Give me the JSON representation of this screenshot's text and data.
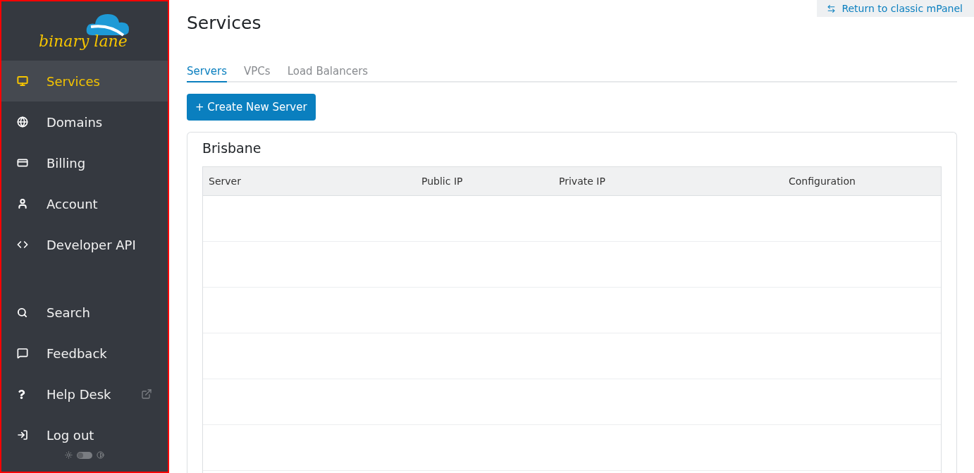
{
  "sidebar": {
    "logo": {
      "text": "binary lane"
    },
    "items": [
      {
        "kind": "monitor",
        "label": "Services",
        "selected": true,
        "external": false
      },
      {
        "kind": "globe",
        "label": "Domains",
        "selected": false,
        "external": false
      },
      {
        "kind": "card",
        "label": "Billing",
        "selected": false,
        "external": false
      },
      {
        "kind": "user",
        "label": "Account",
        "selected": false,
        "external": false
      },
      {
        "kind": "code",
        "label": "Developer API",
        "selected": false,
        "external": false
      }
    ],
    "bottom_items": [
      {
        "kind": "search",
        "label": "Search",
        "selected": false,
        "external": false
      },
      {
        "kind": "feedback",
        "label": "Feedback",
        "selected": false,
        "external": false
      },
      {
        "kind": "help",
        "label": "Help Desk",
        "selected": false,
        "external": true
      },
      {
        "kind": "logout",
        "label": "Log out",
        "selected": false,
        "external": false
      }
    ],
    "theme_toggle": {
      "on": false
    }
  },
  "classic_link": "Return to classic mPanel",
  "page_title": "Services",
  "tabs": [
    {
      "label": "Servers",
      "selected": true
    },
    {
      "label": "VPCs",
      "selected": false
    },
    {
      "label": "Load Balancers",
      "selected": false
    }
  ],
  "create_button": "+ Create New Server",
  "region": {
    "title": "Brisbane",
    "table": {
      "columns": [
        "Server",
        "Public IP",
        "Private IP",
        "Configuration"
      ]
    }
  }
}
